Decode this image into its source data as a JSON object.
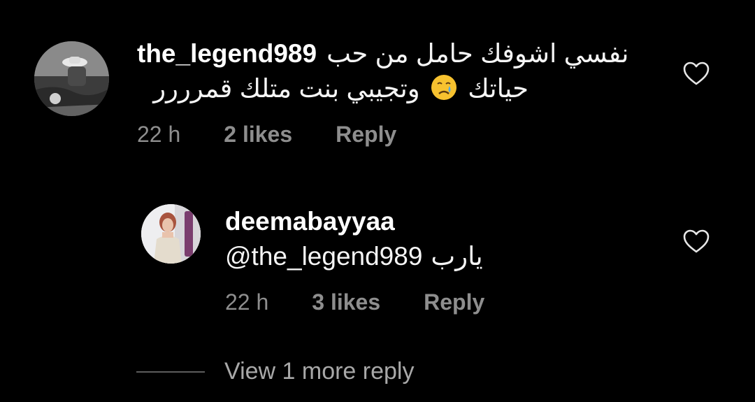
{
  "colors": {
    "background": "#000000",
    "primary_text": "#ffffff",
    "secondary_text": "#8e8e8e",
    "divider": "#5c5c5c"
  },
  "comments": [
    {
      "username": "the_legend989",
      "text_line1": "نفسي اشوفك حامل من حب",
      "text_line2_before_emoji": "حياتك",
      "emoji": "crying-face",
      "text_line2_after_emoji": "وتجيبي بنت متلك قمرررر",
      "time": "22 h",
      "likes": "2 likes",
      "reply_label": "Reply",
      "like_icon": "heart-outline-icon"
    },
    {
      "username": "deemabayyaa",
      "mention": "@the_legend989",
      "text": "يارب",
      "time": "22 h",
      "likes": "3 likes",
      "reply_label": "Reply",
      "like_icon": "heart-outline-icon"
    }
  ],
  "view_more_replies": "View 1 more reply"
}
